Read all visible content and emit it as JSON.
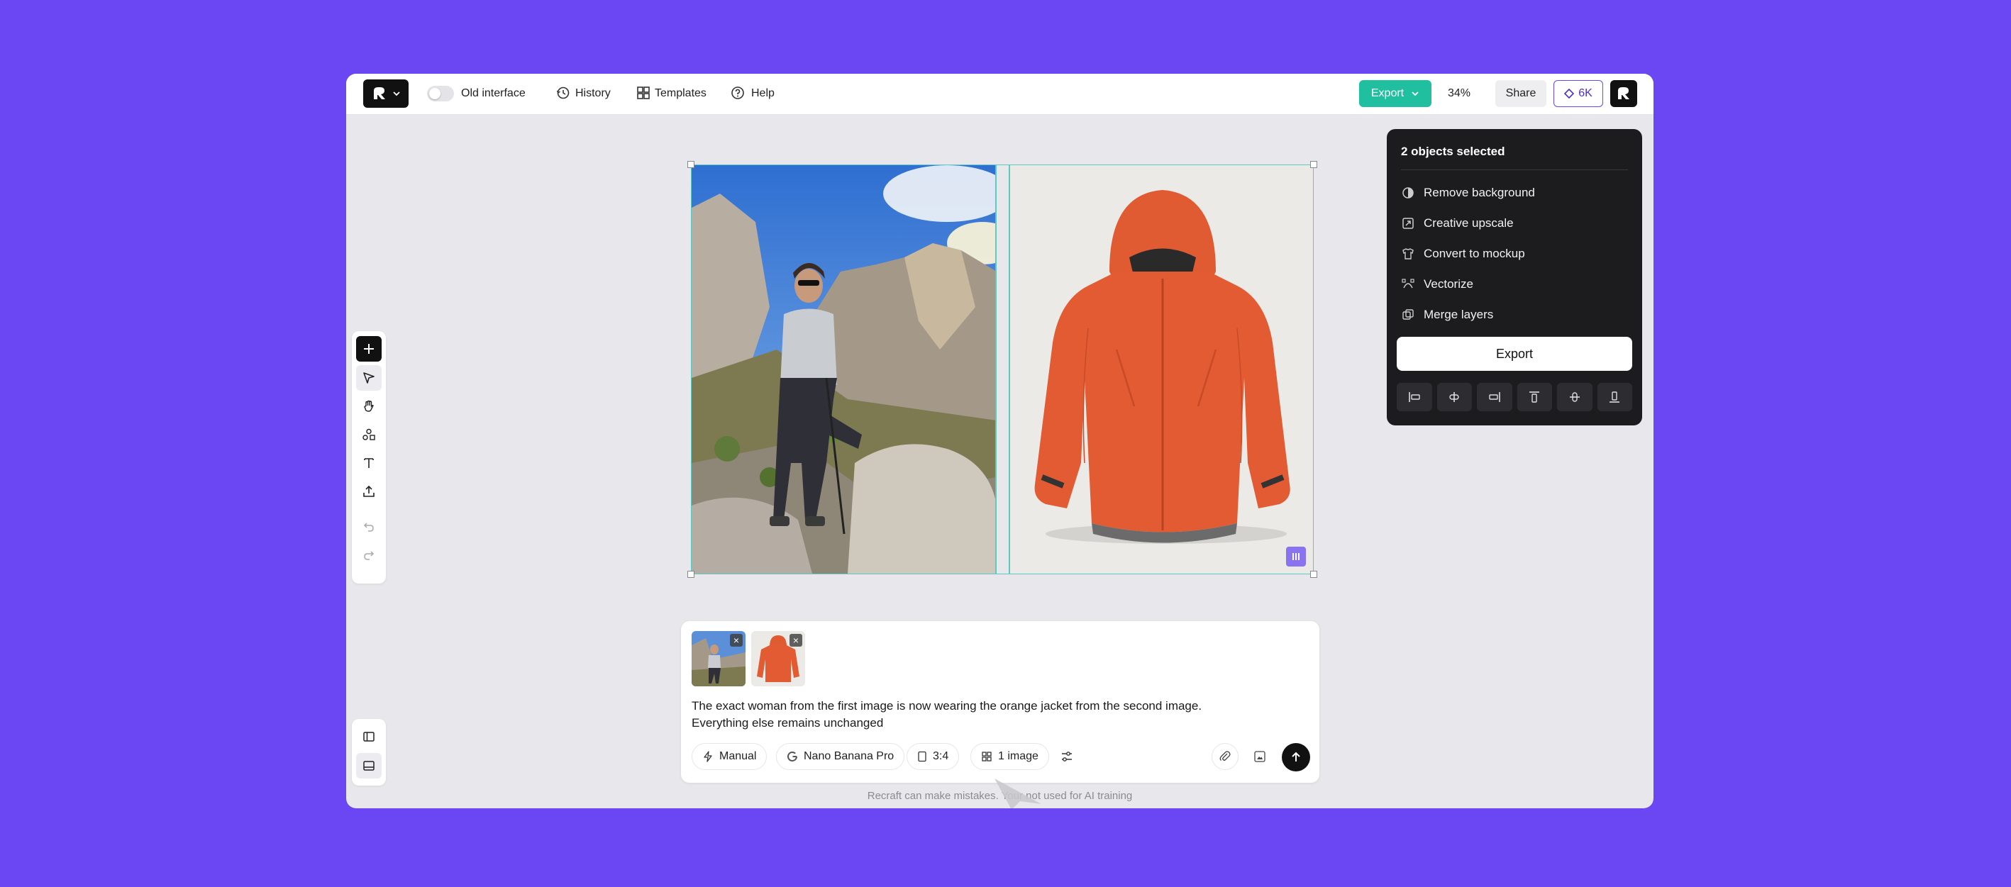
{
  "topbar": {
    "old_interface_label": "Old interface",
    "history_label": "History",
    "templates_label": "Templates",
    "help_label": "Help",
    "export_label": "Export",
    "zoom_level": "34%",
    "share_label": "Share",
    "credits": "6K"
  },
  "panel": {
    "title": "2 objects selected",
    "items": [
      "Remove background",
      "Creative upscale",
      "Convert to mockup",
      "Vectorize",
      "Merge layers"
    ],
    "export_label": "Export"
  },
  "prompt": {
    "text_line1": "The exact woman from the first image is now wearing the orange jacket from the second image.",
    "text_line2": "Everything else remains unchanged",
    "mode_label": "Manual",
    "model_label": "Nano Banana Pro",
    "ratio_label": "3:4",
    "count_label": "1 image"
  },
  "footer": {
    "disclaimer": "Recraft can make mistakes. Your          not used for AI training"
  },
  "colors": {
    "background": "#6b47f3",
    "accent_green": "#1fbf9f",
    "panel_bg": "#1c1c1e",
    "selection": "#5fc8c0"
  }
}
